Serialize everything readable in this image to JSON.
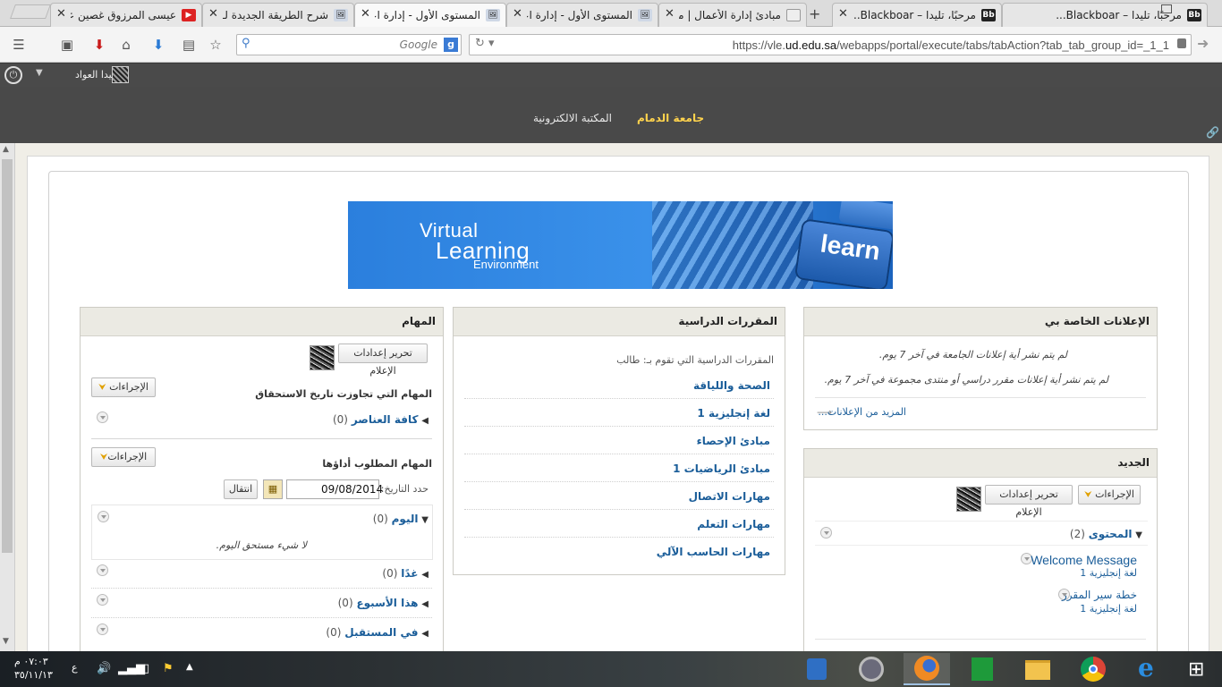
{
  "browser": {
    "tabs": [
      {
        "title": "مرحبًا، تليدا – Blackboar...",
        "favicon": "Bb"
      },
      {
        "title": "مرحبًا، تليدا – Blackboar...",
        "favicon": "Bb"
      },
      {
        "title": "مبادئ إدارة الأعمال | من",
        "favicon": "📄"
      },
      {
        "title": "المستوى الأول - إدارة اعـ",
        "favicon": "🖼"
      },
      {
        "title": "المستوى الأول - إدارة اعـ",
        "favicon": "🖼"
      },
      {
        "title": "شرح الطريقة الجديدة لـ",
        "favicon": "🖼"
      },
      {
        "title": "عيسى المرزوق غصين علـ",
        "favicon": "▶"
      }
    ],
    "search_engine": "Google",
    "url_prefix": "https://vle.",
    "url_host": "ud.edu.sa",
    "url_path": "/webapps/portal/execute/tabs/tabAction?tab_tab_group_id=_1_1"
  },
  "bb": {
    "user_name": "تليدا العواد",
    "nav_tabs": [
      "جامعة الدمام",
      "المكتبة الالكترونية"
    ]
  },
  "banner": {
    "line1": "Virtual",
    "line2": "Learning",
    "line3": "Environment",
    "key_label": "learn"
  },
  "announcements": {
    "title": "الإعلانات الخاصة بي",
    "msg1": "لم يتم نشر أية إعلانات الجامعة في آخر 7 يوم.",
    "msg2": "لم يتم نشر أية إعلانات مقرر دراسي أو منتدى مجموعة في آخر 7 يوم.",
    "more": "المزيد من الإعلانات..."
  },
  "whats_new": {
    "title": "الجديد",
    "actions_label": "الإجراءات",
    "edit_label": "تحرير إعدادات الإعلام",
    "content_label": "المحتوى",
    "content_count": "(2)",
    "items": [
      {
        "title": "Welcome Message",
        "course": "لغة إنجليزية 1"
      },
      {
        "title": "خطة سير المقرر",
        "course": "لغة إنجليزية 1"
      }
    ]
  },
  "courses": {
    "title": "المقررات الدراسية",
    "subtitle": "المقررات الدراسية التي تقوم بـ: طالب",
    "list": [
      "الصحة واللياقة",
      "لغة إنجليزية 1",
      "مبادئ الإحصاء",
      "مبادئ الرياضيات 1",
      "مهارات الاتصال",
      "مهارات التعلم",
      "مهارات الحاسب الآلي"
    ]
  },
  "tasks": {
    "title": "المهام",
    "edit_label": "تحرير إعدادات الإعلام",
    "actions_label": "الإجراءات",
    "overdue_label": "المهام التي تجاوزت تاريخ الاستحقاق",
    "all_items": "كافة العناصر",
    "all_items_count": "(0)",
    "due_label": "المهام المطلوب أداؤها",
    "date_label": "حدد التاريخ:",
    "date_value": "09/08/2014",
    "go_label": "انتقال",
    "today": "اليوم",
    "today_count": "(0)",
    "nothing_due": "لا شيء مستحق اليوم.",
    "tomorrow": "غدًا",
    "tomorrow_count": "(0)",
    "this_week": "هذا الأسبوع",
    "this_week_count": "(0)",
    "future": "في المستقبل",
    "future_count": "(0)"
  },
  "taskbar": {
    "time": "٠٧:٠٣ م",
    "date": "٣٥/١١/١٣",
    "lang": "ع"
  }
}
